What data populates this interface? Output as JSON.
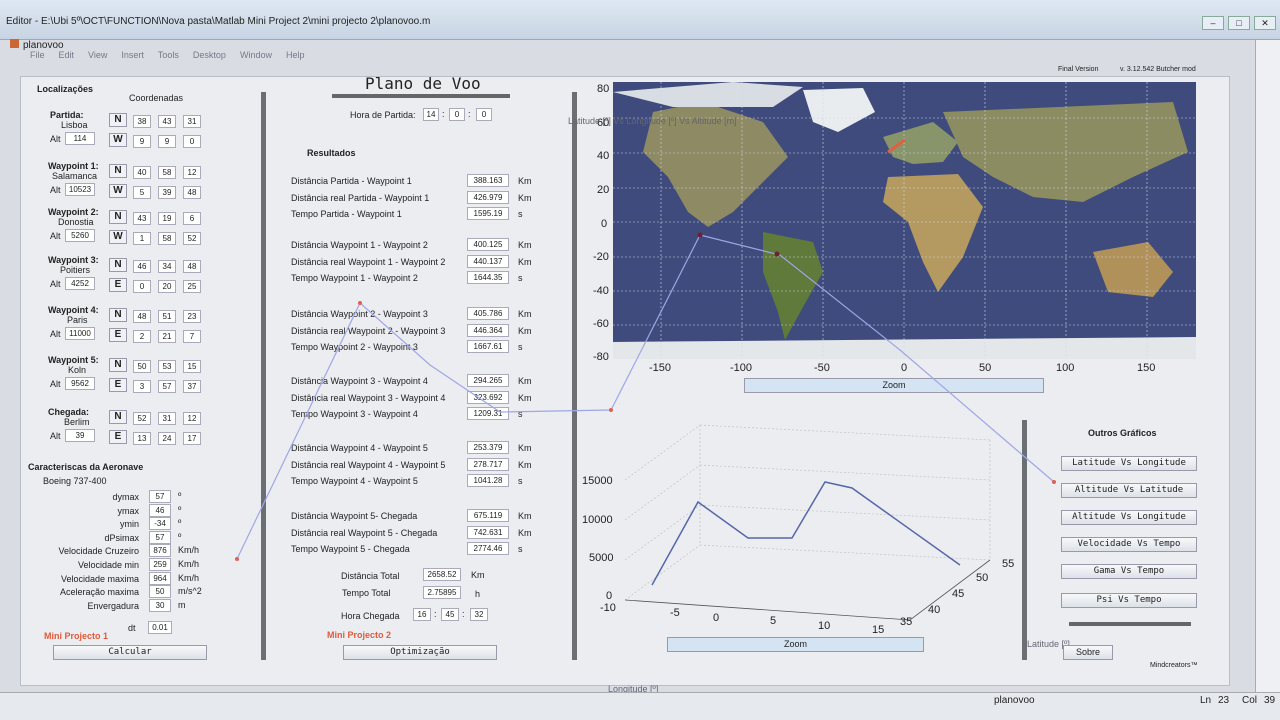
{
  "window": {
    "title": "Editor - E:\\Ubi 5º\\OCT\\FUNCTION\\Nova pasta\\Matlab Mini Project 2\\mini projecto 2\\planovoo.m",
    "subtitle": "planovoo",
    "buttons": [
      "–",
      "□",
      "✕"
    ]
  },
  "menu": [
    "File",
    "Edit",
    "View",
    "Insert",
    "Tools",
    "Desktop",
    "Window",
    "Help"
  ],
  "header": {
    "title": "Plano de Voo",
    "version": "Final Version",
    "credit": "v. 3.12.542 Butcher mod"
  },
  "left": {
    "heading": "Localizações",
    "coords_label": "Coordenadas",
    "points": [
      {
        "label": "Partida:",
        "city": "Lisboa",
        "alt": "114",
        "ns": "N",
        "ew": "W",
        "lat": [
          "38",
          "43",
          "31"
        ],
        "lon": [
          "9",
          "9",
          "0"
        ]
      },
      {
        "label": "Waypoint 1:",
        "city": "Salamanca",
        "alt": "10523",
        "ns": "N",
        "ew": "W",
        "lat": [
          "40",
          "58",
          "12"
        ],
        "lon": [
          "5",
          "39",
          "48"
        ]
      },
      {
        "label": "Waypoint 2:",
        "city": "Donostia",
        "alt": "5260",
        "ns": "N",
        "ew": "W",
        "lat": [
          "43",
          "19",
          "6"
        ],
        "lon": [
          "1",
          "58",
          "52"
        ]
      },
      {
        "label": "Waypoint 3:",
        "city": "Poitiers",
        "alt": "4252",
        "ns": "N",
        "ew": "E",
        "lat": [
          "46",
          "34",
          "48"
        ],
        "lon": [
          "0",
          "20",
          "25"
        ]
      },
      {
        "label": "Waypoint 4:",
        "city": "Paris",
        "alt": "11000",
        "ns": "N",
        "ew": "E",
        "lat": [
          "48",
          "51",
          "23"
        ],
        "lon": [
          "2",
          "21",
          "7"
        ]
      },
      {
        "label": "Waypoint 5:",
        "city": "Koln",
        "alt": "9562",
        "ns": "N",
        "ew": "E",
        "lat": [
          "50",
          "53",
          "15"
        ],
        "lon": [
          "3",
          "57",
          "37"
        ]
      },
      {
        "label": "Chegada:",
        "city": "Berlim",
        "alt": "39",
        "ns": "N",
        "ew": "E",
        "lat": [
          "52",
          "31",
          "12"
        ],
        "lon": [
          "13",
          "24",
          "17"
        ]
      }
    ],
    "alt_label": "Alt",
    "aircraft_heading": "Caracteriscas da Aeronave",
    "aircraft": "Boeing 737-400",
    "params": [
      {
        "name": "dymax",
        "value": "57",
        "unit": "º"
      },
      {
        "name": "ymax",
        "value": "46",
        "unit": "º"
      },
      {
        "name": "ymin",
        "value": "-34",
        "unit": "º"
      },
      {
        "name": "dPsimax",
        "value": "57",
        "unit": "º"
      },
      {
        "name": "Velocidade Cruzeiro",
        "value": "876",
        "unit": "Km/h"
      },
      {
        "name": "Velocidade min",
        "value": "259",
        "unit": "Km/h"
      },
      {
        "name": "Velocidade maxima",
        "value": "964",
        "unit": "Km/h"
      },
      {
        "name": "Aceleração maxima",
        "value": "50",
        "unit": "m/s^2"
      },
      {
        "name": "Envergadura",
        "value": "30",
        "unit": "m"
      }
    ],
    "dt_label": "dt",
    "dt": "0.01",
    "project": "Mini Projecto 1",
    "calc": "Calcular"
  },
  "middle": {
    "departure_label": "Hora de Partida:",
    "departure": [
      "14",
      "0",
      "0"
    ],
    "results_heading": "Resultados",
    "groups": [
      [
        {
          "name": "Distância Partida - Waypoint 1",
          "value": "388.163",
          "unit": "Km"
        },
        {
          "name": "Distância real Partida - Waypoint 1",
          "value": "426.979",
          "unit": "Km"
        },
        {
          "name": "Tempo Partida - Waypoint 1",
          "value": "1595.19",
          "unit": "s"
        }
      ],
      [
        {
          "name": "Distância Waypoint 1 - Waypoint 2",
          "value": "400.125",
          "unit": "Km"
        },
        {
          "name": "Distância real Waypoint 1 - Waypoint 2",
          "value": "440.137",
          "unit": "Km"
        },
        {
          "name": "Tempo Waypoint 1 - Waypoint 2",
          "value": "1644.35",
          "unit": "s"
        }
      ],
      [
        {
          "name": "Distância Waypoint 2 - Waypoint 3",
          "value": "405.786",
          "unit": "Km"
        },
        {
          "name": "Distância real Waypoint 2 - Waypoint 3",
          "value": "446.364",
          "unit": "Km"
        },
        {
          "name": "Tempo Waypoint 2 - Waypoint 3",
          "value": "1667.61",
          "unit": "s"
        }
      ],
      [
        {
          "name": "Distância Waypoint 3 - Waypoint 4",
          "value": "294.265",
          "unit": "Km"
        },
        {
          "name": "Distância real Waypoint 3 - Waypoint 4",
          "value": "323.692",
          "unit": "Km"
        },
        {
          "name": "Tempo Waypoint 3 - Waypoint 4",
          "value": "1209.31",
          "unit": "s"
        }
      ],
      [
        {
          "name": "Distância Waypoint 4 - Waypoint 5",
          "value": "253.379",
          "unit": "Km"
        },
        {
          "name": "Distância real Waypoint 4 - Waypoint 5",
          "value": "278.717",
          "unit": "Km"
        },
        {
          "name": "Tempo Waypoint 4 - Waypoint 5",
          "value": "1041.28",
          "unit": "s"
        }
      ],
      [
        {
          "name": "Distância Waypoint 5- Chegada",
          "value": "675.119",
          "unit": "Km"
        },
        {
          "name": "Distância real Waypoint 5 - Chegada",
          "value": "742.631",
          "unit": "Km"
        },
        {
          "name": "Tempo Waypoint 5 - Chegada",
          "value": "2774.46",
          "unit": "s"
        }
      ]
    ],
    "total_dist_label": "Distância Total",
    "total_dist": "2658.52",
    "total_dist_unit": "Km",
    "total_time_label": "Tempo Total",
    "total_time": "2.75895",
    "total_time_unit": "h",
    "arrival_label": "Hora Chegada",
    "arrival": [
      "16",
      "45",
      "32"
    ],
    "project": "Mini Projecto 2",
    "optim": "Optimização"
  },
  "map": {
    "yticks": [
      "80",
      "60",
      "40",
      "20",
      "0",
      "-20",
      "-40",
      "-60",
      "-80"
    ],
    "xticks": [
      "-150",
      "-100",
      "-50",
      "0",
      "50",
      "100",
      "150"
    ],
    "zoom": "Zoom"
  },
  "plot3d": {
    "zticks": [
      "15000",
      "10000",
      "5000",
      "0"
    ],
    "xticks": [
      "-10",
      "-5",
      "0",
      "5",
      "10",
      "15"
    ],
    "yticks": [
      "35",
      "40",
      "45",
      "50",
      "55"
    ],
    "zoom": "Zoom"
  },
  "right": {
    "heading": "Outros Gráficos",
    "buttons": [
      "Latitude Vs Longitude",
      "Altitude Vs Latitude",
      "Altitude Vs Longitude",
      "Velocidade Vs Tempo",
      "Gama Vs Tempo",
      "Psi Vs Tempo"
    ],
    "about": "Sobre",
    "brand": "Mindcreators™"
  },
  "overlay": {
    "title": "Latitude [º] Vs Longitude [º] Vs Altitude [m]",
    "xlabel": "Longitude [º]",
    "ylabel": "Latitude [º]"
  },
  "status": {
    "file": "planovoo",
    "ln_label": "Ln",
    "ln": "23",
    "col_label": "Col",
    "col": "39"
  }
}
